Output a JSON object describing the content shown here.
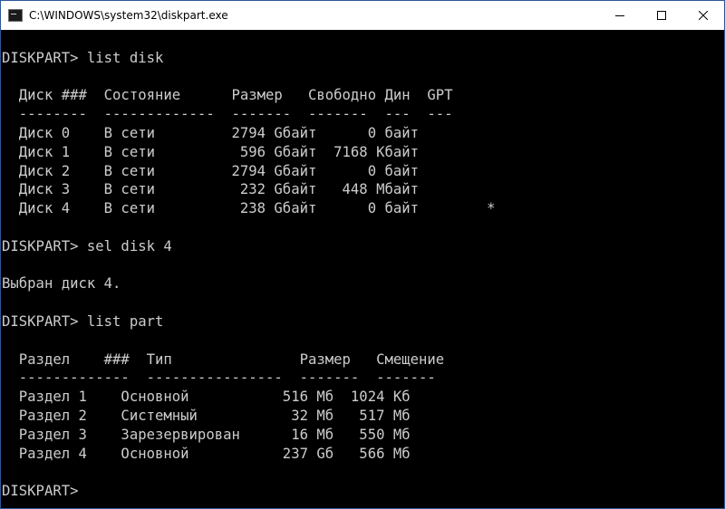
{
  "window": {
    "title": "C:\\WINDOWS\\system32\\diskpart.exe",
    "controls": {
      "minimize_icon": "minimize-icon",
      "maximize_icon": "maximize-icon",
      "close_icon": "close-icon"
    }
  },
  "console": {
    "lines": [
      "",
      "DISKPART> list disk",
      "",
      "  Диск ###  Состояние      Размер   Свободно Дин  GPT",
      "  --------  -------------  -------  -------  ---  ---",
      "  Диск 0    В сети         2794 Gбайт      0 байт",
      "  Диск 1    В сети          596 Gбайт  7168 Kбайт",
      "  Диск 2    В сети         2794 Gбайт      0 байт",
      "  Диск 3    В сети          232 Gбайт   448 Mбайт",
      "  Диск 4    В сети          238 Gбайт      0 байт        *",
      "",
      "DISKPART> sel disk 4",
      "",
      "Выбран диск 4.",
      "",
      "DISKPART> list part",
      "",
      "  Раздел    ###  Тип               Размер   Смещение",
      "  -------------  ----------------  -------  -------",
      "  Раздел 1    Основной           516 Мб  1024 Кб",
      "  Раздел 2    Системный           32 Мб   517 Мб",
      "  Раздел 3    Зарезервирован      16 Мб   550 Мб",
      "  Раздел 4    Основной           237 Gб   566 Мб",
      "",
      "DISKPART> "
    ]
  },
  "colors": {
    "console_bg": "#000000",
    "console_fg": "#cccccc",
    "titlebar_bg": "#ffffff"
  }
}
